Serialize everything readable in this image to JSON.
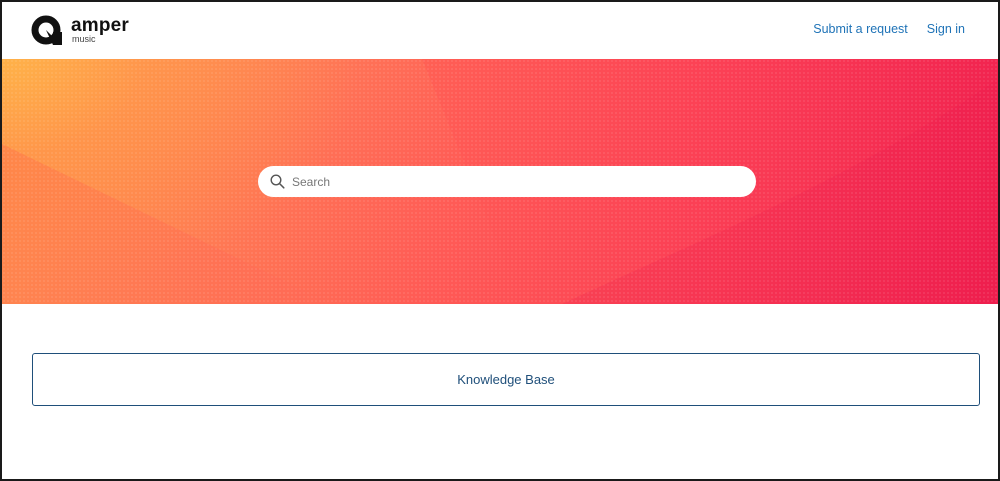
{
  "brand": {
    "name": "amper",
    "subtitle": "music"
  },
  "nav": {
    "submit_request": "Submit a request",
    "sign_in": "Sign in"
  },
  "search": {
    "placeholder": "Search",
    "value": ""
  },
  "categories": [
    {
      "label": "Knowledge Base"
    }
  ],
  "colors": {
    "link": "#1f73b7",
    "category_text": "#1f4f7a",
    "hero_start": "#ff9a4a",
    "hero_end": "#f0204f"
  }
}
